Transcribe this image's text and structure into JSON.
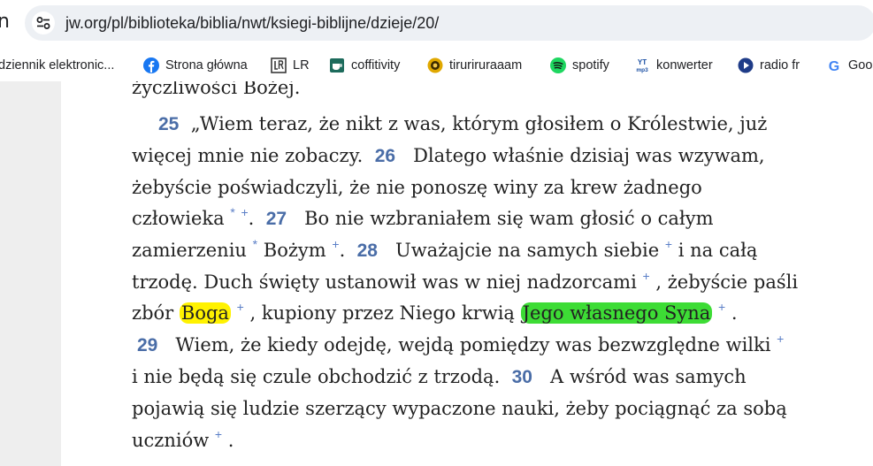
{
  "browser": {
    "tab_partial": "n",
    "url": "jw.org/pl/biblioteka/biblia/nwt/ksiegi-biblijne/dzieje/20/",
    "bookmarks": [
      {
        "label": "dziennik elektronic...",
        "icon": "none"
      },
      {
        "label": "Strona główna",
        "icon": "facebook-icon"
      },
      {
        "label": "LR",
        "icon": "lr-icon"
      },
      {
        "label": "coffitivity",
        "icon": "coffitivity-icon"
      },
      {
        "label": "tiruriruraaam",
        "icon": "tiruriruraaam-icon"
      },
      {
        "label": "spotify",
        "icon": "spotify-icon"
      },
      {
        "label": "konwerter",
        "icon": "yt-mp3-icon"
      },
      {
        "label": "radio fr",
        "icon": "radio-fr-icon"
      },
      {
        "label": "Goo",
        "icon": "google-icon"
      }
    ]
  },
  "colors": {
    "verse_number": "#4a6da7",
    "footnote_mark": "#5b7fc7",
    "highlight_yellow": "#fff200",
    "highlight_green": "#3ddc35"
  },
  "article": {
    "l0": "życzliwości Bożej.",
    "l1": {
      "v25": "25",
      "t1": "„Wiem teraz, że nikt z was, którym głosiłem o Królestwie, już"
    },
    "l2": {
      "t1": "więcej mnie nie zobaczy.",
      "v26": "26",
      "t2": "Dlatego właśnie dzisiaj was wzywam,"
    },
    "l3": "żebyście poświadczyli, że nie ponoszę winy za krew żadnego",
    "l4": {
      "t1": "człowieka",
      "m1": "*",
      "m2": "+",
      "t2": ".",
      "v27": "27",
      "t3": "Bo nie wzbraniałem się wam głosić o całym"
    },
    "l5": {
      "t1": "zamierzeniu",
      "m1": "*",
      "t2": "Bożym",
      "m2": "+",
      "t3": ".",
      "v28": "28",
      "t4": "Uważajcie na samych siebie",
      "m3": "+",
      "t5": "i na całą"
    },
    "l6": {
      "t1": "trzodę. Duch święty ustanowił was w niej nadzorcami",
      "m1": "+",
      "t2": ", żebyście paśli"
    },
    "l7": {
      "t1": "zbór",
      "hl1": "Boga",
      "m1": "+",
      "t2": ", kupiony przez Niego krwią",
      "hl2": "Jego własnego Syna",
      "m2": "+",
      "t3": "."
    },
    "l8": {
      "v29": "29",
      "t1": "Wiem, że kiedy odejdę, wejdą pomiędzy was bezwzględne wilki",
      "m1": "+"
    },
    "l9": {
      "t1": "i nie będą się czule obchodzić z trzodą.",
      "v30": "30",
      "t2": "A wśród was samych"
    },
    "l10": "pojawią się ludzie szerzący wypaczone nauki, żeby pociągnąć za sobą",
    "l11": {
      "t1": "uczniów",
      "m1": "+",
      "t2": "."
    }
  }
}
